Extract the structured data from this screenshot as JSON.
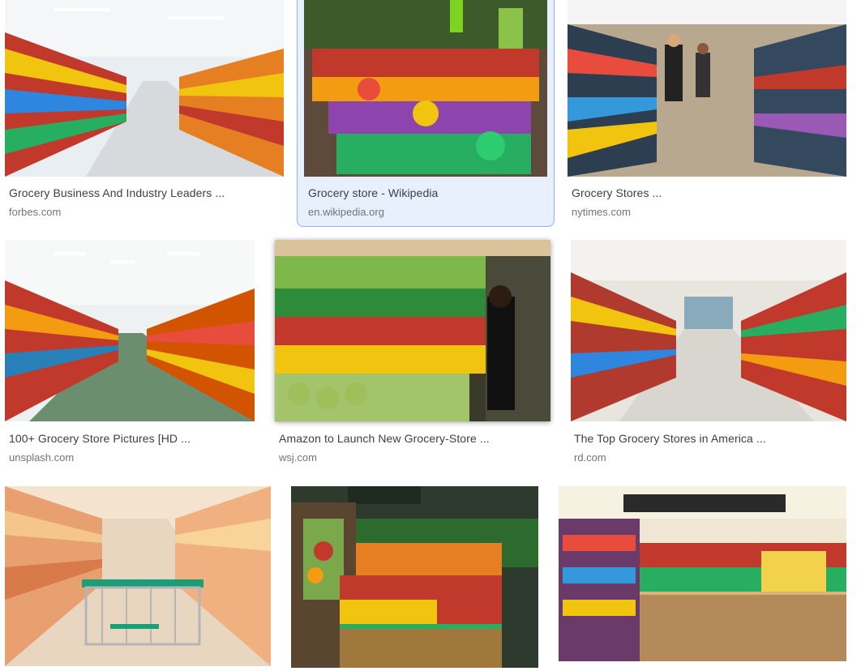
{
  "results": [
    {
      "title": "Grocery Business And Industry Leaders ...",
      "source": "forbes.com"
    },
    {
      "title": "Grocery store - Wikipedia",
      "source": "en.wikipedia.org",
      "selected": true
    },
    {
      "title": "Grocery Stores ...",
      "source": "nytimes.com"
    },
    {
      "title": "100+ Grocery Store Pictures [HD ...",
      "source": "unsplash.com"
    },
    {
      "title": "Amazon to Launch New Grocery-Store ...",
      "source": "wsj.com"
    },
    {
      "title": "The Top Grocery Stores in America ...",
      "source": "rd.com"
    },
    {
      "title": "",
      "source": ""
    },
    {
      "title": "",
      "source": ""
    },
    {
      "title": "",
      "source": ""
    }
  ],
  "colors": {
    "selected_bg": "#e8f0fe",
    "selected_border": "#8ab4f8",
    "title": "#3c4043",
    "source": "#70757a"
  }
}
